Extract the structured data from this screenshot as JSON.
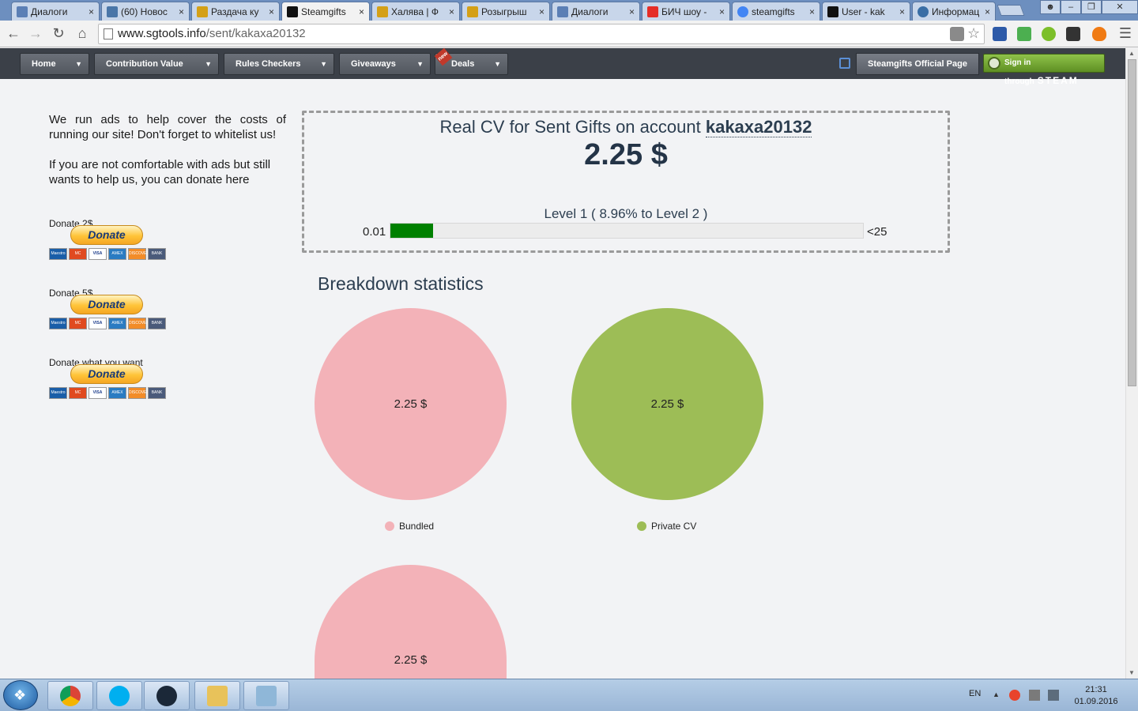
{
  "browser": {
    "tabs": [
      {
        "title": "Диалоги",
        "color": "#5b7fb5"
      },
      {
        "title": "(60) Новос",
        "color": "#4a76a8"
      },
      {
        "title": "Раздача ку",
        "color": "#d4a017"
      },
      {
        "title": "Steamgifts",
        "color": "#111111"
      },
      {
        "title": "Халява | Ф",
        "color": "#d4a017"
      },
      {
        "title": "Розыгрыш",
        "color": "#d4a017"
      },
      {
        "title": "Диалоги",
        "color": "#5b7fb5"
      },
      {
        "title": "БИЧ шоу -",
        "color": "#e52d27"
      },
      {
        "title": "steamgifts",
        "color": "#4285f4"
      },
      {
        "title": "User - kak",
        "color": "#111111"
      },
      {
        "title": "Информац",
        "color": "#3a6ea5"
      }
    ],
    "tab_close": "×",
    "url_domain": "www.sgtools.info",
    "url_path": "/sent/kakaxa20132"
  },
  "site_nav": {
    "items": [
      {
        "label": "Home"
      },
      {
        "label": "Contribution Value"
      },
      {
        "label": "Rules Checkers"
      },
      {
        "label": "Giveaways"
      },
      {
        "label": "Deals"
      }
    ],
    "new_badge": "new",
    "official_page": "Steamgifts Official Page",
    "sign_in": "Sign in through",
    "sign_in_brand": "STEAM"
  },
  "sidebar": {
    "ads_text": "We run ads to help cover the costs of running our site! Don't forget to whitelist us!",
    "donate_text": "If you are not comfortable with ads but still wants to help us, you can donate here",
    "donations": [
      {
        "label": "Donate 2$",
        "button": "Donate"
      },
      {
        "label": "Donate 5$",
        "button": "Donate"
      },
      {
        "label": "Donate what you want",
        "button": "Donate"
      }
    ],
    "cards": [
      "Maestro",
      "MC",
      "VISA",
      "AMEX",
      "DISCOVER",
      "BANK"
    ]
  },
  "cv": {
    "title_prefix": "Real CV for Sent Gifts on account",
    "account": "kakaxa20132",
    "value": "2.25 $",
    "level_text": "Level 1 ( 8.96% to Level 2 )",
    "progress_fraction": 0.0896,
    "bar_min": "0.01",
    "bar_max": "<25"
  },
  "breakdown": {
    "title": "Breakdown statistics",
    "charts": [
      {
        "label": "2.25 $",
        "legend": "Bundled",
        "color": "#f3b2b8"
      },
      {
        "label": "2.25 $",
        "legend": "Private CV",
        "color": "#9dbd56"
      },
      {
        "label": "2.25 $",
        "legend": "",
        "color": "#f3b2b8"
      }
    ]
  },
  "taskbar": {
    "lang": "EN",
    "time": "21:31",
    "date": "01.09.2016"
  }
}
